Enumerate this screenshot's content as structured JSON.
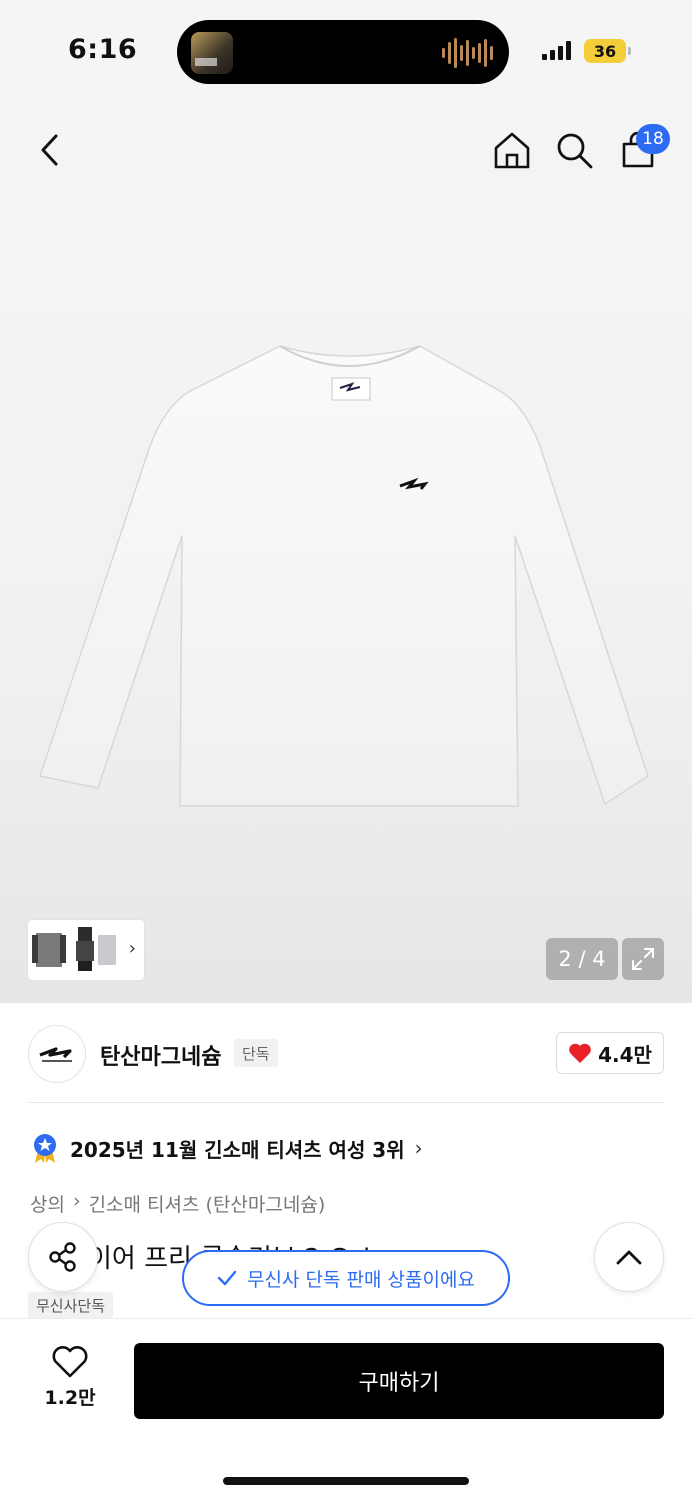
{
  "status_bar": {
    "time": "6:16",
    "battery": "36",
    "colors": {
      "battery": "#f4cd3b"
    }
  },
  "header": {
    "cart_count": "18"
  },
  "gallery": {
    "counter": "2 / 4"
  },
  "brand": {
    "name": "탄산마그네슘",
    "tag": "단독",
    "likes": "4.4만"
  },
  "ranking": {
    "text": "2025년 11월 긴소매 티셔츠 여성 3위"
  },
  "breadcrumb": {
    "category": "상의",
    "subcategory": "긴소매 티셔츠 (탄산마그네슘)"
  },
  "product": {
    "title": "이어 프리 롱슬리브 2 Color",
    "tag": "무신사단독"
  },
  "toast": {
    "text": "무신사 단독 판매 상품이에요"
  },
  "bottom_bar": {
    "wish_count": "1.2만",
    "buy_label": "구매하기"
  },
  "colors": {
    "accent": "#2d6cf2",
    "buy_button": "#000000",
    "heart": "#e8202a"
  }
}
